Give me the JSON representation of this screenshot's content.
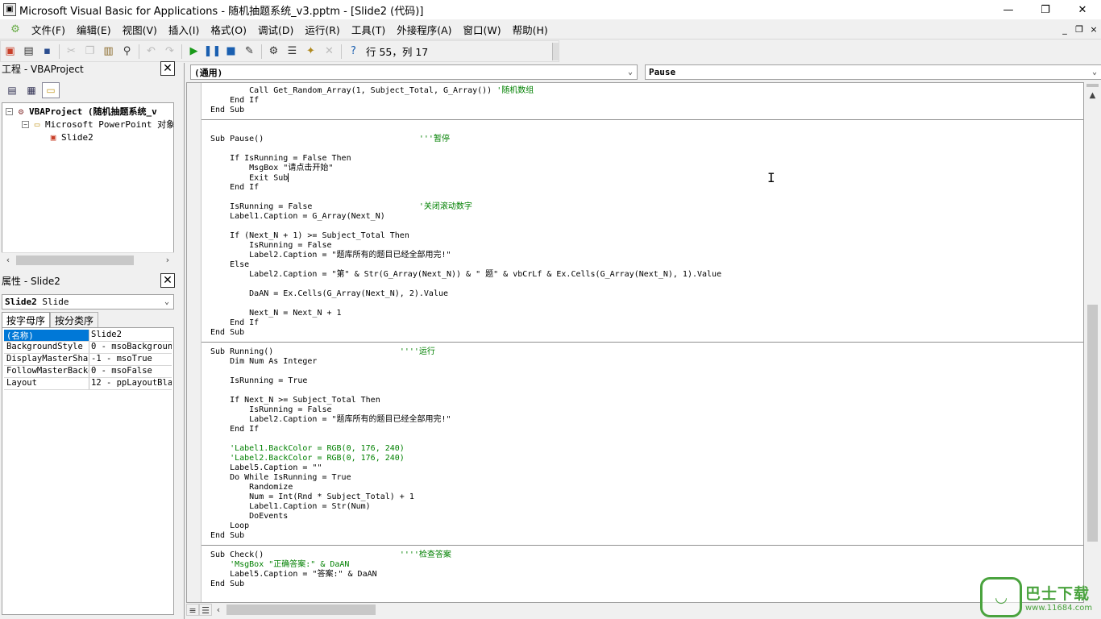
{
  "window": {
    "title": "Microsoft Visual Basic for Applications - 随机抽题系统_v3.pptm - [Slide2 (代码)]",
    "icon": "vba-window-icon",
    "controls": [
      "—",
      "❐",
      "✕"
    ]
  },
  "menubar": {
    "items": [
      "文件(F)",
      "编辑(E)",
      "视图(V)",
      "插入(I)",
      "格式(O)",
      "调试(D)",
      "运行(R)",
      "工具(T)",
      "外接程序(A)",
      "窗口(W)",
      "帮助(H)"
    ],
    "mdi_controls": [
      "_",
      "❐",
      "×"
    ]
  },
  "toolbar": {
    "position_text": "行 55，列 17"
  },
  "project_pane": {
    "title": "工程 - VBAProject",
    "close": "✕",
    "tree": [
      {
        "label": "VBAProject (随机抽题系统_v",
        "expander": "−",
        "bold": true
      },
      {
        "label": "Microsoft PowerPoint 对象",
        "expander": "−",
        "bold": false
      },
      {
        "label": "Slide2",
        "expander": "",
        "bold": false
      }
    ]
  },
  "properties_pane": {
    "title": "属性 - Slide2",
    "close": "✕",
    "object_combo": {
      "name": "Slide2",
      "type": "Slide"
    },
    "tabs": [
      "按字母序",
      "按分类序"
    ],
    "rows": [
      {
        "key": "(名称)",
        "value": "Slide2"
      },
      {
        "key": "BackgroundStyle",
        "value": "0 - msoBackgroun"
      },
      {
        "key": "DisplayMasterShape",
        "value": "-1 - msoTrue"
      },
      {
        "key": "FollowMasterBackgr",
        "value": "0 - msoFalse"
      },
      {
        "key": "Layout",
        "value": "12 - ppLayoutBla"
      }
    ]
  },
  "code_window": {
    "object_combo": "(通用)",
    "procedure_combo": "Pause",
    "lines": [
      {
        "segs": [
          {
            "t": "        Call Get_Random_Array(1, Subject_Total, G_Array()) "
          },
          {
            "t": "'随机数组",
            "c": "cm"
          }
        ]
      },
      {
        "segs": [
          {
            "t": "    End If"
          }
        ]
      },
      {
        "segs": [
          {
            "t": "End Sub"
          }
        ]
      },
      {
        "segs": [
          {
            "t": ""
          }
        ]
      },
      {
        "segs": [
          {
            "t": ""
          }
        ]
      },
      {
        "segs": [
          {
            "t": "Sub Pause()                                "
          },
          {
            "t": "'''暂停",
            "c": "cm"
          }
        ]
      },
      {
        "segs": [
          {
            "t": ""
          }
        ]
      },
      {
        "segs": [
          {
            "t": "    If IsRunning = False Then"
          }
        ]
      },
      {
        "segs": [
          {
            "t": "        MsgBox \"请点击开始\""
          }
        ]
      },
      {
        "segs": [
          {
            "t": "        Exit Sub"
          }
        ]
      },
      {
        "segs": [
          {
            "t": "    End If"
          }
        ]
      },
      {
        "segs": [
          {
            "t": ""
          }
        ]
      },
      {
        "segs": [
          {
            "t": "    IsRunning = False                      "
          },
          {
            "t": "'关闭滚动数字",
            "c": "cm"
          }
        ]
      },
      {
        "segs": [
          {
            "t": "    Label1.Caption = G_Array(Next_N)"
          }
        ]
      },
      {
        "segs": [
          {
            "t": ""
          }
        ]
      },
      {
        "segs": [
          {
            "t": "    If (Next_N + 1) >= Subject_Total Then"
          }
        ]
      },
      {
        "segs": [
          {
            "t": "        IsRunning = False"
          }
        ]
      },
      {
        "segs": [
          {
            "t": "        Label2.Caption = \"题库所有的题目已经全部用完!\""
          }
        ]
      },
      {
        "segs": [
          {
            "t": "    Else"
          }
        ]
      },
      {
        "segs": [
          {
            "t": "        Label2.Caption = \"第\" & Str(G_Array(Next_N)) & \" 题\" & vbCrLf & Ex.Cells(G_Array(Next_N), 1).Value"
          }
        ]
      },
      {
        "segs": [
          {
            "t": ""
          }
        ]
      },
      {
        "segs": [
          {
            "t": "        DaAN = Ex.Cells(G_Array(Next_N), 2).Value"
          }
        ]
      },
      {
        "segs": [
          {
            "t": ""
          }
        ]
      },
      {
        "segs": [
          {
            "t": "        Next_N = Next_N + 1"
          }
        ]
      },
      {
        "segs": [
          {
            "t": "    End If"
          }
        ]
      },
      {
        "segs": [
          {
            "t": "End Sub"
          }
        ]
      },
      {
        "segs": [
          {
            "t": ""
          }
        ]
      },
      {
        "segs": [
          {
            "t": "Sub Running()                          "
          },
          {
            "t": "''''运行",
            "c": "cm"
          }
        ]
      },
      {
        "segs": [
          {
            "t": "    Dim Num As Integer"
          }
        ]
      },
      {
        "segs": [
          {
            "t": ""
          }
        ]
      },
      {
        "segs": [
          {
            "t": "    IsRunning = True"
          }
        ]
      },
      {
        "segs": [
          {
            "t": ""
          }
        ]
      },
      {
        "segs": [
          {
            "t": "    If Next_N >= Subject_Total Then"
          }
        ]
      },
      {
        "segs": [
          {
            "t": "        IsRunning = False"
          }
        ]
      },
      {
        "segs": [
          {
            "t": "        Label2.Caption = \"题库所有的题目已经全部用完!\""
          }
        ]
      },
      {
        "segs": [
          {
            "t": "    End If"
          }
        ]
      },
      {
        "segs": [
          {
            "t": ""
          }
        ]
      },
      {
        "segs": [
          {
            "t": "    'Label1.BackColor = RGB(0, 176, 240)",
            "c": "cm"
          }
        ]
      },
      {
        "segs": [
          {
            "t": "    'Label2.BackColor = RGB(0, 176, 240)",
            "c": "cm"
          }
        ]
      },
      {
        "segs": [
          {
            "t": "    Label5.Caption = \"\""
          }
        ]
      },
      {
        "segs": [
          {
            "t": "    Do While IsRunning = True"
          }
        ]
      },
      {
        "segs": [
          {
            "t": "        Randomize"
          }
        ]
      },
      {
        "segs": [
          {
            "t": "        Num = Int(Rnd * Subject_Total) + 1"
          }
        ]
      },
      {
        "segs": [
          {
            "t": "        Label1.Caption = Str(Num)"
          }
        ]
      },
      {
        "segs": [
          {
            "t": "        DoEvents"
          }
        ]
      },
      {
        "segs": [
          {
            "t": "    Loop"
          }
        ]
      },
      {
        "segs": [
          {
            "t": "End Sub"
          }
        ]
      },
      {
        "segs": [
          {
            "t": ""
          }
        ]
      },
      {
        "segs": [
          {
            "t": "Sub Check()                            "
          },
          {
            "t": "''''检查答案",
            "c": "cm"
          }
        ]
      },
      {
        "segs": [
          {
            "t": "    'MsgBox \"正确答案:\" & DaAN",
            "c": "cm"
          }
        ]
      },
      {
        "segs": [
          {
            "t": "    Label5.Caption = \"答案:\" & DaAN"
          }
        ]
      },
      {
        "segs": [
          {
            "t": "End Sub"
          }
        ]
      }
    ]
  },
  "watermark": {
    "brand": "巴士下载",
    "url": "www.11684.com"
  },
  "colors": {
    "comment": "#008000",
    "selection": "#0078d7",
    "watermark": "#4aa33e"
  }
}
